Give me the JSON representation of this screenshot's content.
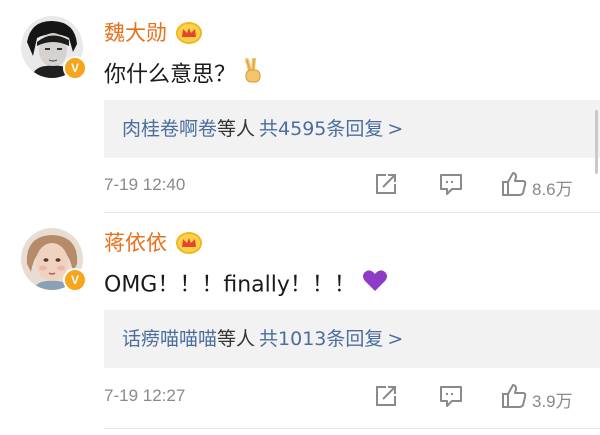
{
  "comments": [
    {
      "username": "魏大勋",
      "text": "你什么意思？",
      "emoji": "victory-hand",
      "verified": "V",
      "replies_user": "肉桂卷啊卷",
      "replies_suffix": "等人",
      "replies_count": "共4595条回复",
      "replies_chevron": ">",
      "time": "7-19 12:40",
      "likes": "8.6万"
    },
    {
      "username": "蒋依依",
      "text": "OMG！！！finally！！！",
      "emoji": "purple-heart",
      "verified": "V",
      "replies_user": "话痨喵喵喵",
      "replies_suffix": "等人",
      "replies_count": "共1013条回复",
      "replies_chevron": ">",
      "time": "7-19 12:27",
      "likes": "3.9万"
    }
  ],
  "colors": {
    "username": "#e8711b",
    "link": "#4c6d9e",
    "meta": "#8a8a8a",
    "reply_bg": "#f2f2f2",
    "heart": "#8e3cc7",
    "badge": "#f7a51c"
  }
}
